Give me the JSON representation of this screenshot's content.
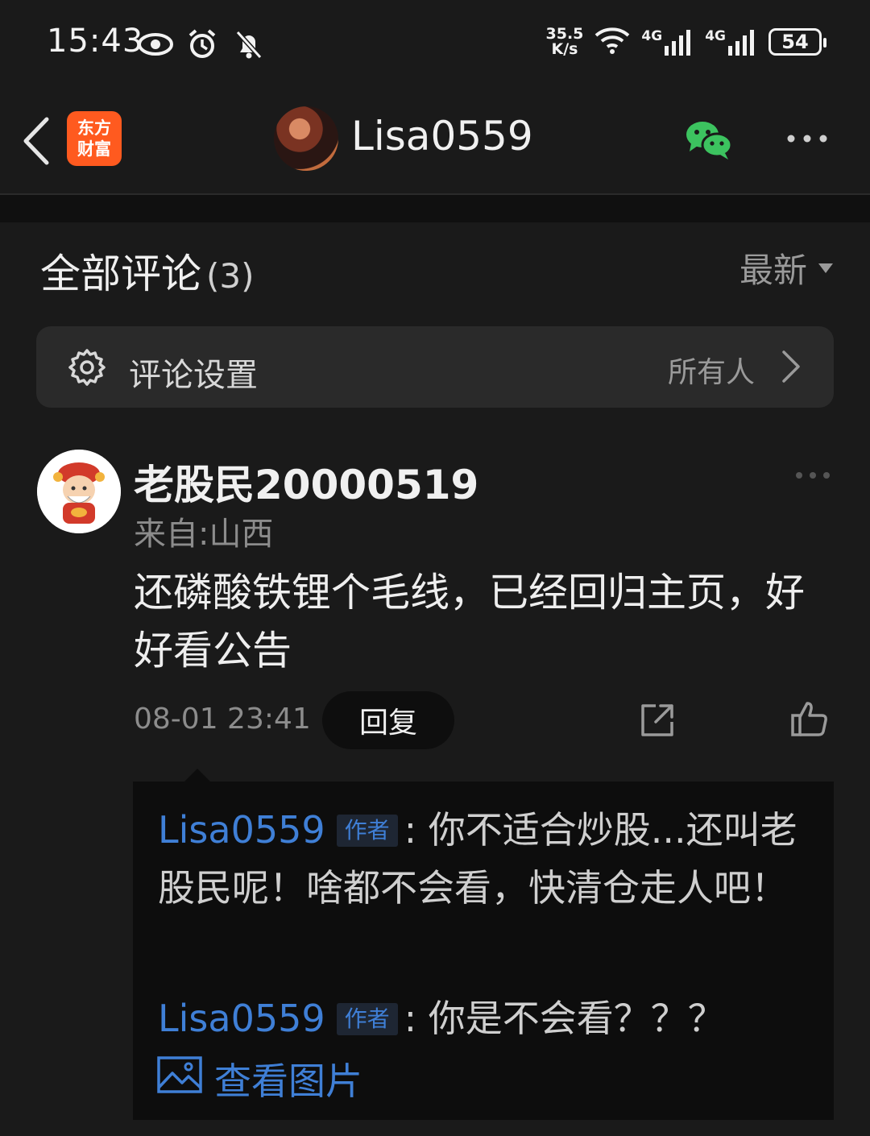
{
  "status_bar": {
    "time": "15:43",
    "net_speed_value": "35.5",
    "net_speed_unit": "K/s",
    "signal1": "4G",
    "signal2": "4G",
    "battery": "54"
  },
  "nav": {
    "app_logo_line1": "东方",
    "app_logo_line2": "财富",
    "title": "Lisa0559"
  },
  "comments_header": {
    "title": "全部评论",
    "count": "(3)",
    "sort_label": "最新"
  },
  "settings": {
    "label": "评论设置",
    "value": "所有人"
  },
  "comment": {
    "author": "老股民20000519",
    "location": "来自:山西",
    "text": "还磷酸铁锂个毛线，已经回归主页，好好看公告",
    "time": "08-01 23:41",
    "reply_label": "回复"
  },
  "replies": [
    {
      "author": "Lisa0559",
      "tag": "作者",
      "separator": ":",
      "text": "你不适合炒股...还叫老股民呢！啥都不会看，快清仓走人吧！"
    },
    {
      "author": "Lisa0559",
      "tag": "作者",
      "separator": ":",
      "text": "你是不会看？？？"
    }
  ],
  "view_image_label": "查看图片",
  "colors": {
    "background": "#1a1a1a",
    "link": "#3f7fd6",
    "logo": "#ff5a1f",
    "wechat": "#3cc35f"
  }
}
